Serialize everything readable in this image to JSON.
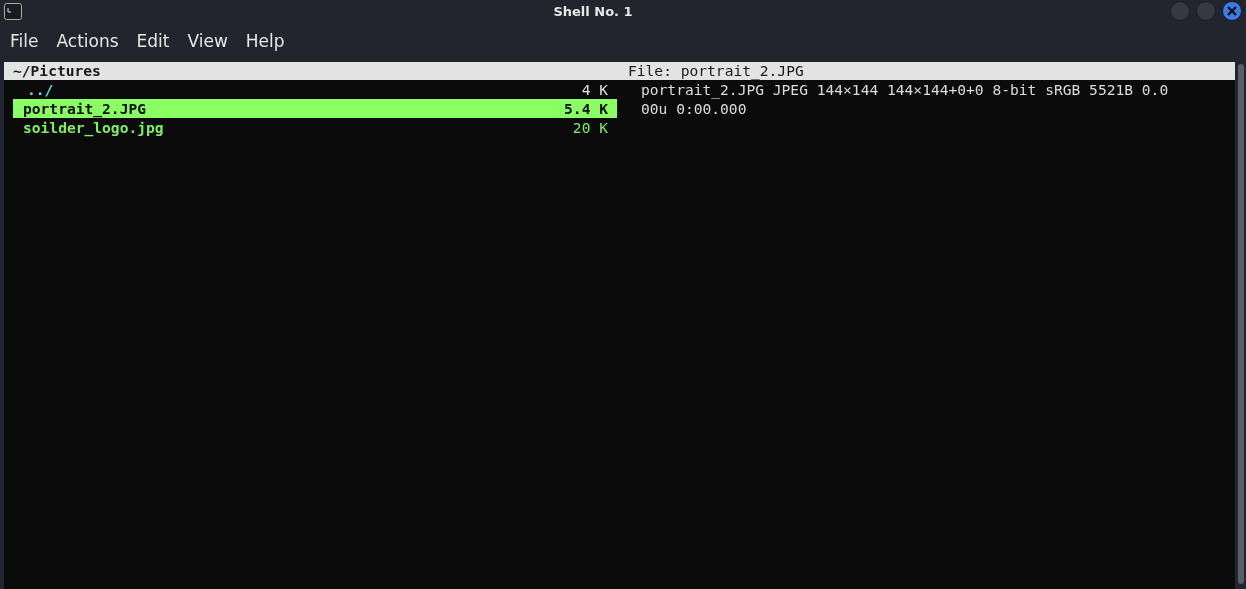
{
  "window": {
    "title": "Shell No. 1"
  },
  "menu": [
    "File",
    "Actions",
    "Edit",
    "View",
    "Help"
  ],
  "ranger": {
    "path": "~/Pictures",
    "file_info": "File: portrait_2.JPG",
    "entries": [
      {
        "name": "../",
        "size": "4 K",
        "kind": "dir",
        "selected": false
      },
      {
        "name": "portrait_2.JPG",
        "size": "5.4 K",
        "kind": "file",
        "selected": true
      },
      {
        "name": "soilder_logo.jpg",
        "size": "20 K",
        "kind": "file",
        "selected": false
      }
    ],
    "preview": [
      "portrait_2.JPG JPEG 144×144 144×144+0+0 8-bit sRGB 5521B 0.0",
      "00u 0:00.000"
    ]
  }
}
